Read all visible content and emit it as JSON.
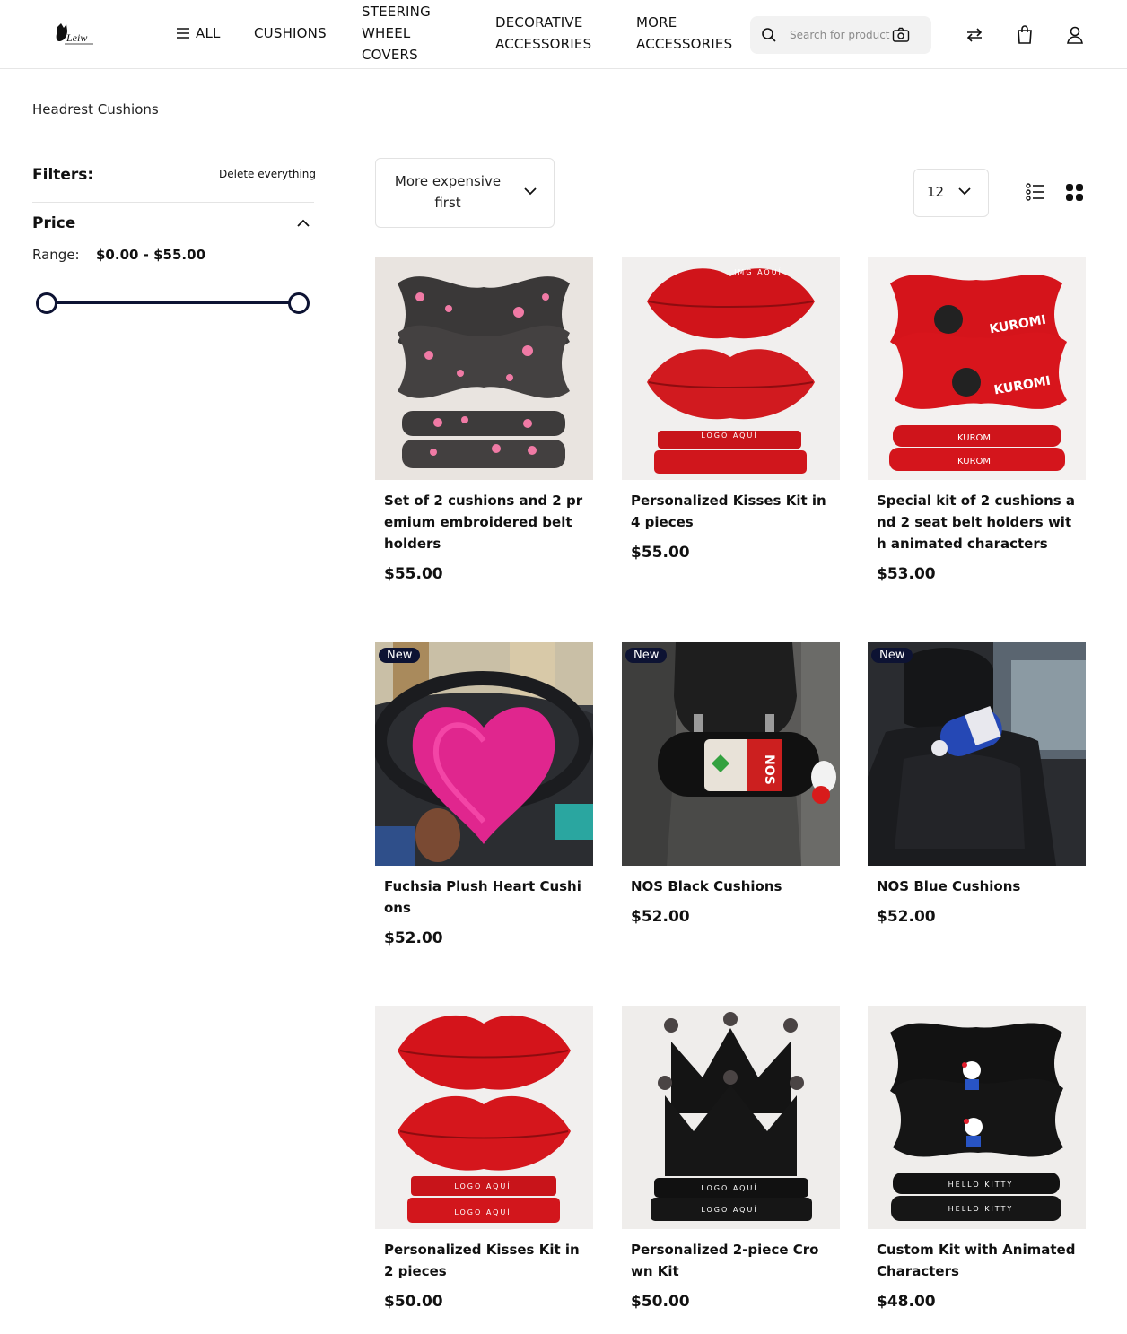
{
  "header": {
    "logo_text": "Leiw",
    "nav": {
      "all": "ALL",
      "cushions": "CUSHIONS",
      "steering": "STEERING WHEEL COVERS",
      "decorative": "DECORATIVE ACCESSORIES",
      "more": "MORE ACCESSORIES"
    },
    "search_placeholder": "Search for product"
  },
  "breadcrumb": "Headrest Cushions",
  "filters": {
    "title": "Filters:",
    "delete_all": "Delete everything",
    "price": {
      "title": "Price",
      "range_label": "Range:",
      "range_value": "$0.00 - $55.00",
      "min": 0,
      "max": 55
    }
  },
  "toolbar": {
    "sort_label": "More expensive first",
    "per_page": "12"
  },
  "colors": {
    "accent": "#0d1333",
    "badge": "#0d1333"
  },
  "products": [
    {
      "name": "Set of 2 cushions and 2 premium embroidered belt holders",
      "price": "$55.00",
      "badge": ""
    },
    {
      "name": "Personalized Kisses Kit in 4 pieces",
      "price": "$55.00",
      "badge": "",
      "img_text": "IMG AQUÍ",
      "img_text2": "LOGO AQUÍ"
    },
    {
      "name": "Special kit of 2 cushions and 2 seat belt holders with animated characters",
      "price": "$53.00",
      "badge": "",
      "img_text": "KUROMI"
    },
    {
      "name": "Fuchsia Plush Heart Cushions",
      "price": "$52.00",
      "badge": "New"
    },
    {
      "name": "NOS Black Cushions",
      "price": "$52.00",
      "badge": "New",
      "img_text": "NOS"
    },
    {
      "name": "NOS Blue Cushions",
      "price": "$52.00",
      "badge": "New"
    },
    {
      "name": "Personalized Kisses Kit in 2 pieces",
      "price": "$50.00",
      "badge": "",
      "img_text": "LOGO AQUÍ"
    },
    {
      "name": "Personalized 2-piece Crown Kit",
      "price": "$50.00",
      "badge": "",
      "img_text": "LOGO AQUÍ"
    },
    {
      "name": "Custom Kit with Animated Characters",
      "price": "$48.00",
      "badge": "",
      "img_text": "HELLO KITTY"
    }
  ]
}
